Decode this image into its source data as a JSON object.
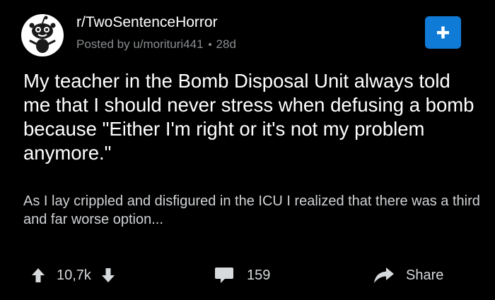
{
  "post": {
    "subreddit": "r/TwoSentenceHorror",
    "posted_by": "Posted by u/morituri441",
    "age": "28d",
    "title": "My teacher in the Bomb Disposal Unit always told me that I should never stress when defusing a bomb because \"Either I'm right or it's not my problem anymore.\"",
    "body": "As I lay crippled and disfigured in the ICU I realized that there was a third and far worse option...",
    "join_icon": "plus-icon",
    "subreddit_icon": "snoo-avatar-icon"
  },
  "actions": {
    "score": "10,7k",
    "comments": "159",
    "share_label": "Share",
    "upvote_icon": "arrow-up-icon",
    "downvote_icon": "arrow-down-icon",
    "comment_icon": "comment-bubble-icon",
    "share_icon": "share-arrow-icon"
  },
  "colors": {
    "background": "#000000",
    "title_text": "#ffffff",
    "meta_text": "#8a8d90",
    "join_button": "#0f7bd6"
  }
}
